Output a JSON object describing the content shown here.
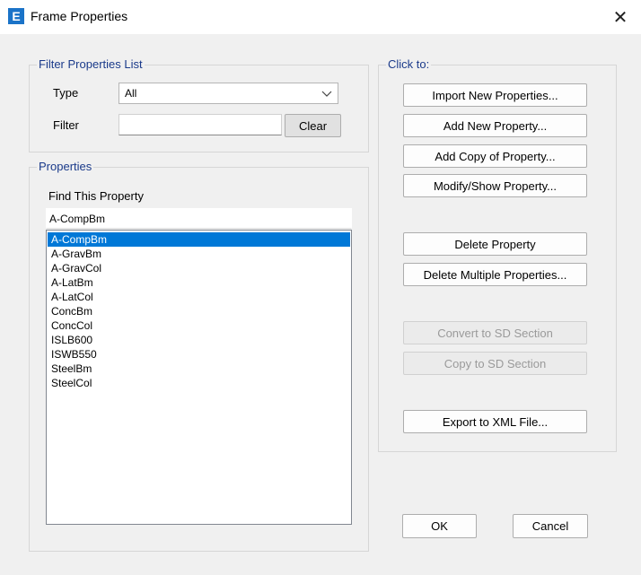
{
  "window": {
    "title": "Frame Properties",
    "app_icon_letter": "E",
    "close_glyph": "✕"
  },
  "filter": {
    "group_label": "Filter Properties List",
    "type_label": "Type",
    "type_value": "All",
    "filter_label": "Filter",
    "filter_value": "",
    "clear_label": "Clear"
  },
  "properties": {
    "group_label": "Properties",
    "find_label": "Find This Property",
    "find_value": "A-CompBm",
    "items": [
      "A-CompBm",
      "A-GravBm",
      "A-GravCol",
      "A-LatBm",
      "A-LatCol",
      "ConcBm",
      "ConcCol",
      "ISLB600",
      "ISWB550",
      "SteelBm",
      "SteelCol"
    ],
    "selected_index": 0
  },
  "actions": {
    "group_label": "Click to:",
    "import": "Import New Properties...",
    "add_new": "Add New Property...",
    "add_copy": "Add Copy of Property...",
    "modify": "Modify/Show Property...",
    "delete": "Delete Property",
    "delete_multiple": "Delete Multiple Properties...",
    "convert_sd": "Convert to SD Section",
    "copy_sd": "Copy to SD Section",
    "export_xml": "Export to XML File..."
  },
  "footer": {
    "ok": "OK",
    "cancel": "Cancel"
  }
}
